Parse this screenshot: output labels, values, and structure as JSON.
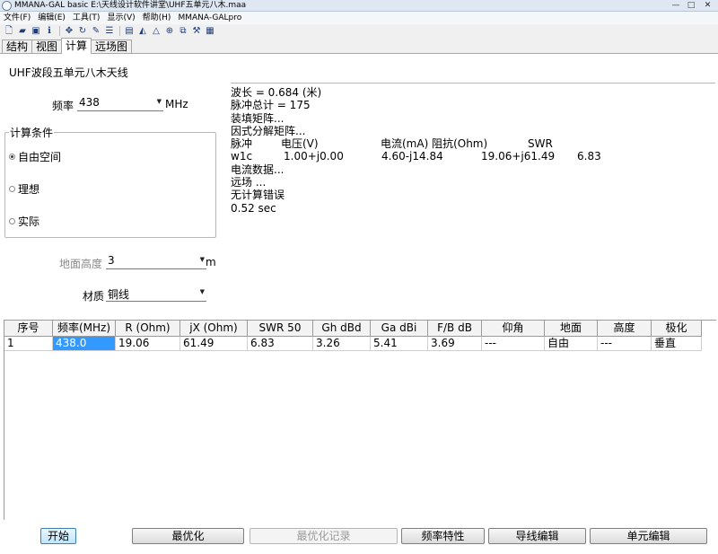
{
  "window": {
    "title": "MMANA-GAL basic E:\\天线设计软件讲堂\\UHF五单元八木.maa",
    "controls": [
      "—",
      "□",
      "✕"
    ]
  },
  "menu": [
    "文件(F)",
    "编辑(E)",
    "工具(T)",
    "显示(V)",
    "帮助(H)",
    "MMANA-GALpro"
  ],
  "toolbar": [
    {
      "icon": "new-file-icon",
      "glyph": "🗋"
    },
    {
      "icon": "open-folder-icon",
      "glyph": "▰"
    },
    {
      "icon": "save-icon",
      "glyph": "▣"
    },
    {
      "icon": "info-icon",
      "glyph": "ℹ"
    },
    {
      "icon": "move-icon",
      "glyph": "✥"
    },
    {
      "icon": "rotate-icon",
      "glyph": "↻"
    },
    {
      "icon": "edit-icon",
      "glyph": "✎"
    },
    {
      "icon": "list-icon",
      "glyph": "☰"
    },
    {
      "icon": "doc-icon",
      "glyph": "▤"
    },
    {
      "icon": "flag-icon",
      "glyph": "◭"
    },
    {
      "icon": "triangle-icon",
      "glyph": "△"
    },
    {
      "icon": "target-icon",
      "glyph": "⊕"
    },
    {
      "icon": "copy-icon",
      "glyph": "⧉"
    },
    {
      "icon": "tools-icon",
      "glyph": "⚒"
    },
    {
      "icon": "calculator-icon",
      "glyph": "▦"
    }
  ],
  "tabs": [
    "结构",
    "视图",
    "计算",
    "远场图"
  ],
  "active_tab": "计算",
  "antenna_name": "UHF波段五单元八木天线",
  "frequency": {
    "label": "频率",
    "value": "438",
    "unit": "MHz"
  },
  "calc_conditions": {
    "title": "计算条件",
    "options": [
      "自由空间",
      "理想",
      "实际"
    ],
    "selected": "自由空间"
  },
  "ground_height": {
    "label": "地面高度",
    "value": "3",
    "unit": "m"
  },
  "material": {
    "label": "材质",
    "value": "铜线"
  },
  "results": {
    "wavelength": "波长 = 0.684 (米)",
    "pulse_total": "脉冲总计 = 175",
    "fill_matrix": "装填矩阵...",
    "factor_matrix": "因式分解矩阵...",
    "header": {
      "pulse": "脉冲",
      "voltage": "电压(V)",
      "current_impedance": "电流(mA) 阻抗(Ohm)",
      "swr": "SWR"
    },
    "row": {
      "pulse": "w1c",
      "voltage": "1.00+j0.00",
      "current": "4.60-j14.84",
      "impedance": "19.06+j61.49",
      "swr": "6.83"
    },
    "current_data": "电流数据...",
    "far_field": "远场 ...",
    "no_error": "无计算错误",
    "time": "0.52 sec"
  },
  "table": {
    "columns": [
      "序号",
      "频率(MHz)",
      "R (Ohm)",
      "jX (Ohm)",
      "SWR 50",
      "Gh dBd",
      "Ga dBi",
      "F/B dB",
      "仰角",
      "地面",
      "高度",
      "极化"
    ],
    "rows": [
      [
        "1",
        "438.0",
        "19.06",
        "61.49",
        "6.83",
        "3.26",
        "5.41",
        "3.69",
        "---",
        "自由",
        "---",
        "垂直"
      ]
    ]
  },
  "buttons": {
    "start": "开始",
    "optimize": "最优化",
    "optimize_log": "最优化记录",
    "freq_char": "频率特性",
    "wire_edit": "导线编辑",
    "element_edit": "单元编辑"
  }
}
